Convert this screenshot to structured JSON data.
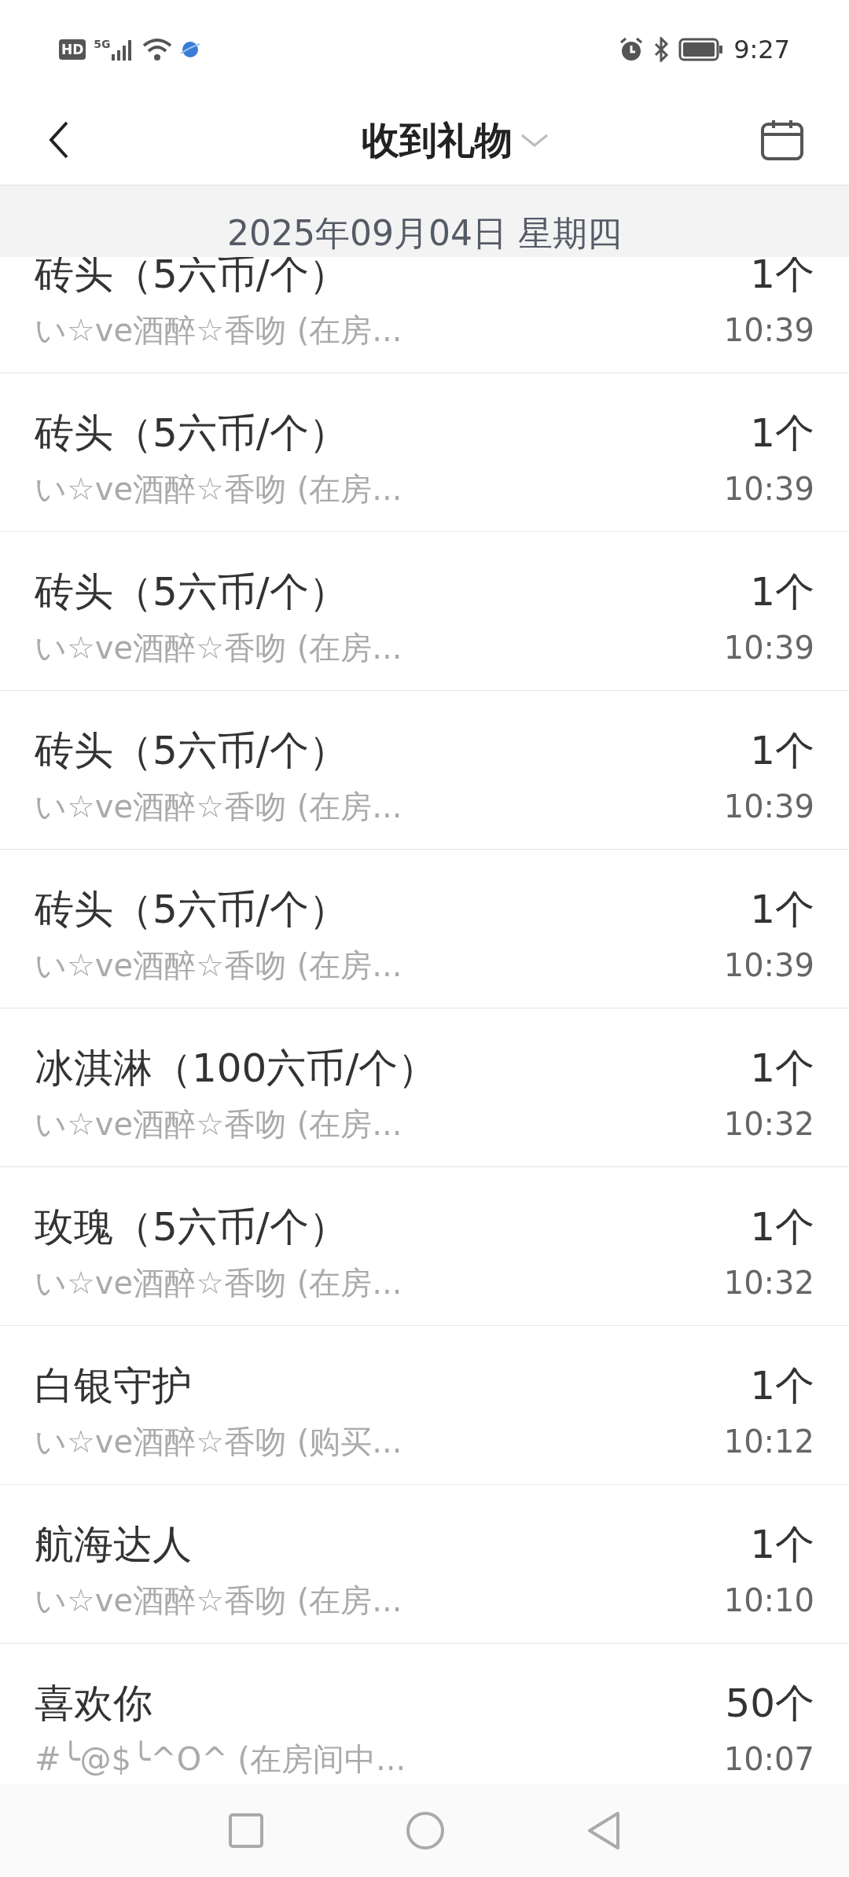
{
  "status_bar": {
    "left": "HD",
    "network": "5G",
    "time": "9:27"
  },
  "header": {
    "title": "收到礼物"
  },
  "date_band": "2025年09月04日 星期四",
  "gifts": [
    {
      "name": "砖头（5六币/个）",
      "sender": "い☆ve酒醉☆香吻 (在房...",
      "count": "1个",
      "time": "10:39"
    },
    {
      "name": "砖头（5六币/个）",
      "sender": "い☆ve酒醉☆香吻 (在房...",
      "count": "1个",
      "time": "10:39"
    },
    {
      "name": "砖头（5六币/个）",
      "sender": "い☆ve酒醉☆香吻 (在房...",
      "count": "1个",
      "time": "10:39"
    },
    {
      "name": "砖头（5六币/个）",
      "sender": "い☆ve酒醉☆香吻 (在房...",
      "count": "1个",
      "time": "10:39"
    },
    {
      "name": "砖头（5六币/个）",
      "sender": "い☆ve酒醉☆香吻 (在房...",
      "count": "1个",
      "time": "10:39"
    },
    {
      "name": "冰淇淋（100六币/个）",
      "sender": "い☆ve酒醉☆香吻 (在房...",
      "count": "1个",
      "time": "10:32"
    },
    {
      "name": "玫瑰（5六币/个）",
      "sender": "い☆ve酒醉☆香吻 (在房...",
      "count": "1个",
      "time": "10:32"
    },
    {
      "name": "白银守护",
      "sender": "い☆ve酒醉☆香吻 (购买...",
      "count": "1个",
      "time": "10:12"
    },
    {
      "name": "航海达人",
      "sender": "い☆ve酒醉☆香吻 (在房...",
      "count": "1个",
      "time": "10:10"
    },
    {
      "name": "喜欢你",
      "sender": "#╰@$╰^O^ (在房间中...",
      "count": "50个",
      "time": "10:07"
    }
  ]
}
